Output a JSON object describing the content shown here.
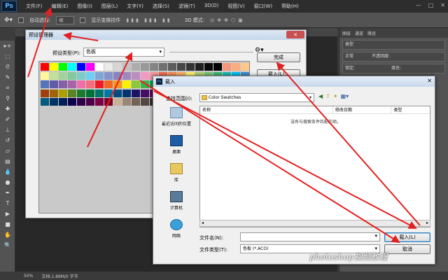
{
  "app": {
    "logo": "Ps"
  },
  "menu": [
    "文件(F)",
    "编辑(E)",
    "图像(I)",
    "图层(L)",
    "文字(Y)",
    "选择(S)",
    "滤镜(T)",
    "3D(D)",
    "视图(V)",
    "窗口(W)",
    "帮助(H)"
  ],
  "window_controls": [
    "—",
    "□",
    "✕"
  ],
  "options_bar": {
    "auto_select": "自动选择:",
    "auto_select_value": "组",
    "show_transform": "显示变换控件",
    "mode_3d": "3D 模式:"
  },
  "right_panel": {
    "tabs": [
      "图层",
      "通道",
      "路径"
    ],
    "kind": "类型",
    "blend": "正常",
    "opacity": "不透明度:",
    "lock": "锁定:",
    "fill": "填充:"
  },
  "statusbar": {
    "zoom": "50%",
    "doc": "文档:1.89M/0 字节"
  },
  "preset_manager": {
    "title": "预设管理器",
    "type_label": "预设类型(P):",
    "type_value": "色板",
    "done_button": "完成",
    "load_button": "载入(L)...",
    "swatch_colors": [
      [
        "#ff0000",
        "#ffff00",
        "#00ff00",
        "#00ffff",
        "#0000ff",
        "#ff00ff",
        "#ffffff",
        "#ebebeb",
        "#d6d6d6",
        "#c2c2c2",
        "#adadad",
        "#999999",
        "#858585",
        "#707070",
        "#5c5c5c",
        "#474747",
        "#333333",
        "#1f1f1f",
        "#0a0a0a",
        "#000000",
        "#f7977a",
        "#f9ad81",
        "#fdc68a"
      ],
      [
        "#fff79a",
        "#c4df9b",
        "#a3d39c",
        "#82ca9d",
        "#7bcdc8",
        "#6ecff6",
        "#7ea7d8",
        "#8493ca",
        "#8882be",
        "#a187be",
        "#bc8dbf",
        "#f49ac2",
        "#f6989d",
        "#f26c4f",
        "#f68e55",
        "#fbaf5c",
        "#fff467",
        "#acd372",
        "#7cc576",
        "#3bb878",
        "#1abbb4",
        "#00bff3",
        "#438cca"
      ],
      [
        "#5574b9",
        "#605ca8",
        "#855fa8",
        "#a763a8",
        "#f06ea9",
        "#f26d7d",
        "#ed1c24",
        "#f26522",
        "#f7941d",
        "#fff200",
        "#8dc73f",
        "#39b54a",
        "#00a651",
        "#00a99d",
        "#00aeef",
        "#0072bc",
        "#0054a6",
        "#2e3192",
        "#662d91",
        "#92278f",
        "#ec008c",
        "#ed145b",
        "#9e0b0f"
      ],
      [
        "#a0410d",
        "#a36209",
        "#aba000",
        "#598527",
        "#1a7b30",
        "#007236",
        "#00746b",
        "#0076a3",
        "#004b80",
        "#003471",
        "#1b1464",
        "#440e62",
        "#630460",
        "#9e005d",
        "#9e0039",
        "#790000",
        "#7b2e00",
        "#7d4900",
        "#827b00",
        "#406618",
        "#005e20",
        "#005826",
        "#005952"
      ],
      [
        "#005b7f",
        "#003663",
        "#002157",
        "#0d004c",
        "#32004b",
        "#4b0049",
        "#7b0046",
        "#7a0026",
        "#c7b299",
        "#998675",
        "#736357",
        "#534741",
        "#37302d",
        "#c69c6d",
        "#a67c52",
        "#8c6239",
        "#754c24",
        "#603913"
      ]
    ]
  },
  "load_dialog": {
    "title": "载入",
    "look_in_label": "查找范围(I):",
    "look_in_value": "Color Swatches",
    "places": [
      "最近访问的位置",
      "桌面",
      "库",
      "计算机",
      "网络"
    ],
    "columns": [
      "名称",
      "修改日期",
      "类型"
    ],
    "empty_text": "没有与搜索条件匹配的项。",
    "filename_label": "文件名(N):",
    "filename_value": "",
    "filetype_label": "文件类型(T):",
    "filetype_value": "色板 (*.ACO)",
    "load_button": "载入(L)",
    "cancel_button": "取消"
  },
  "watermark": "photoshop视频教程"
}
